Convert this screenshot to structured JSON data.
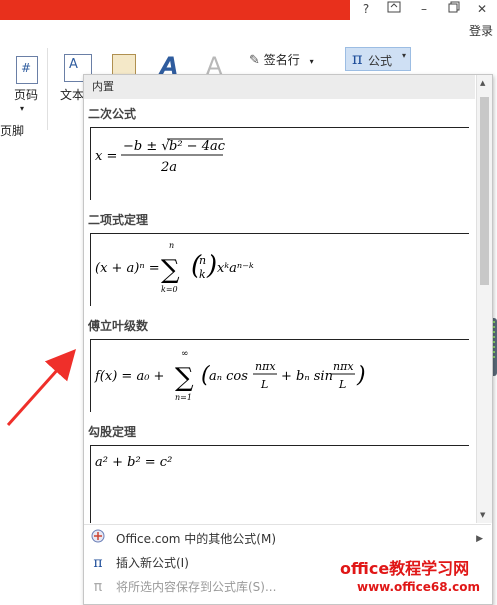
{
  "window": {
    "help": "?",
    "restore": "🗗",
    "minimize": "–",
    "maximize": "□",
    "close": "✕",
    "login": "登录"
  },
  "ribbon": {
    "page_number_label": "页码",
    "text_label": "文本",
    "footer_label": "页脚",
    "signature_label": "签名行",
    "equation_label": "公式",
    "equation_symbol": "π"
  },
  "dropdown": {
    "header": "内置",
    "equations": [
      {
        "title": "二次公式"
      },
      {
        "title": "二项式定理"
      },
      {
        "title": "傅立叶级数"
      },
      {
        "title": "勾股定理"
      }
    ],
    "menu": [
      {
        "label": "Office.com 中的其他公式(M)",
        "icon": "office-icon"
      },
      {
        "label": "插入新公式(I)",
        "icon": "pi-icon"
      },
      {
        "label": "将所选内容保存到公式库(S)...",
        "icon": "save-equation-icon"
      }
    ]
  },
  "watermark": {
    "line1": "office教程学习网",
    "line2": "www.office68.com"
  },
  "colors": {
    "title_bar": "#e8301c",
    "accent": "#1f4e9a",
    "watermark": "#e01717"
  }
}
